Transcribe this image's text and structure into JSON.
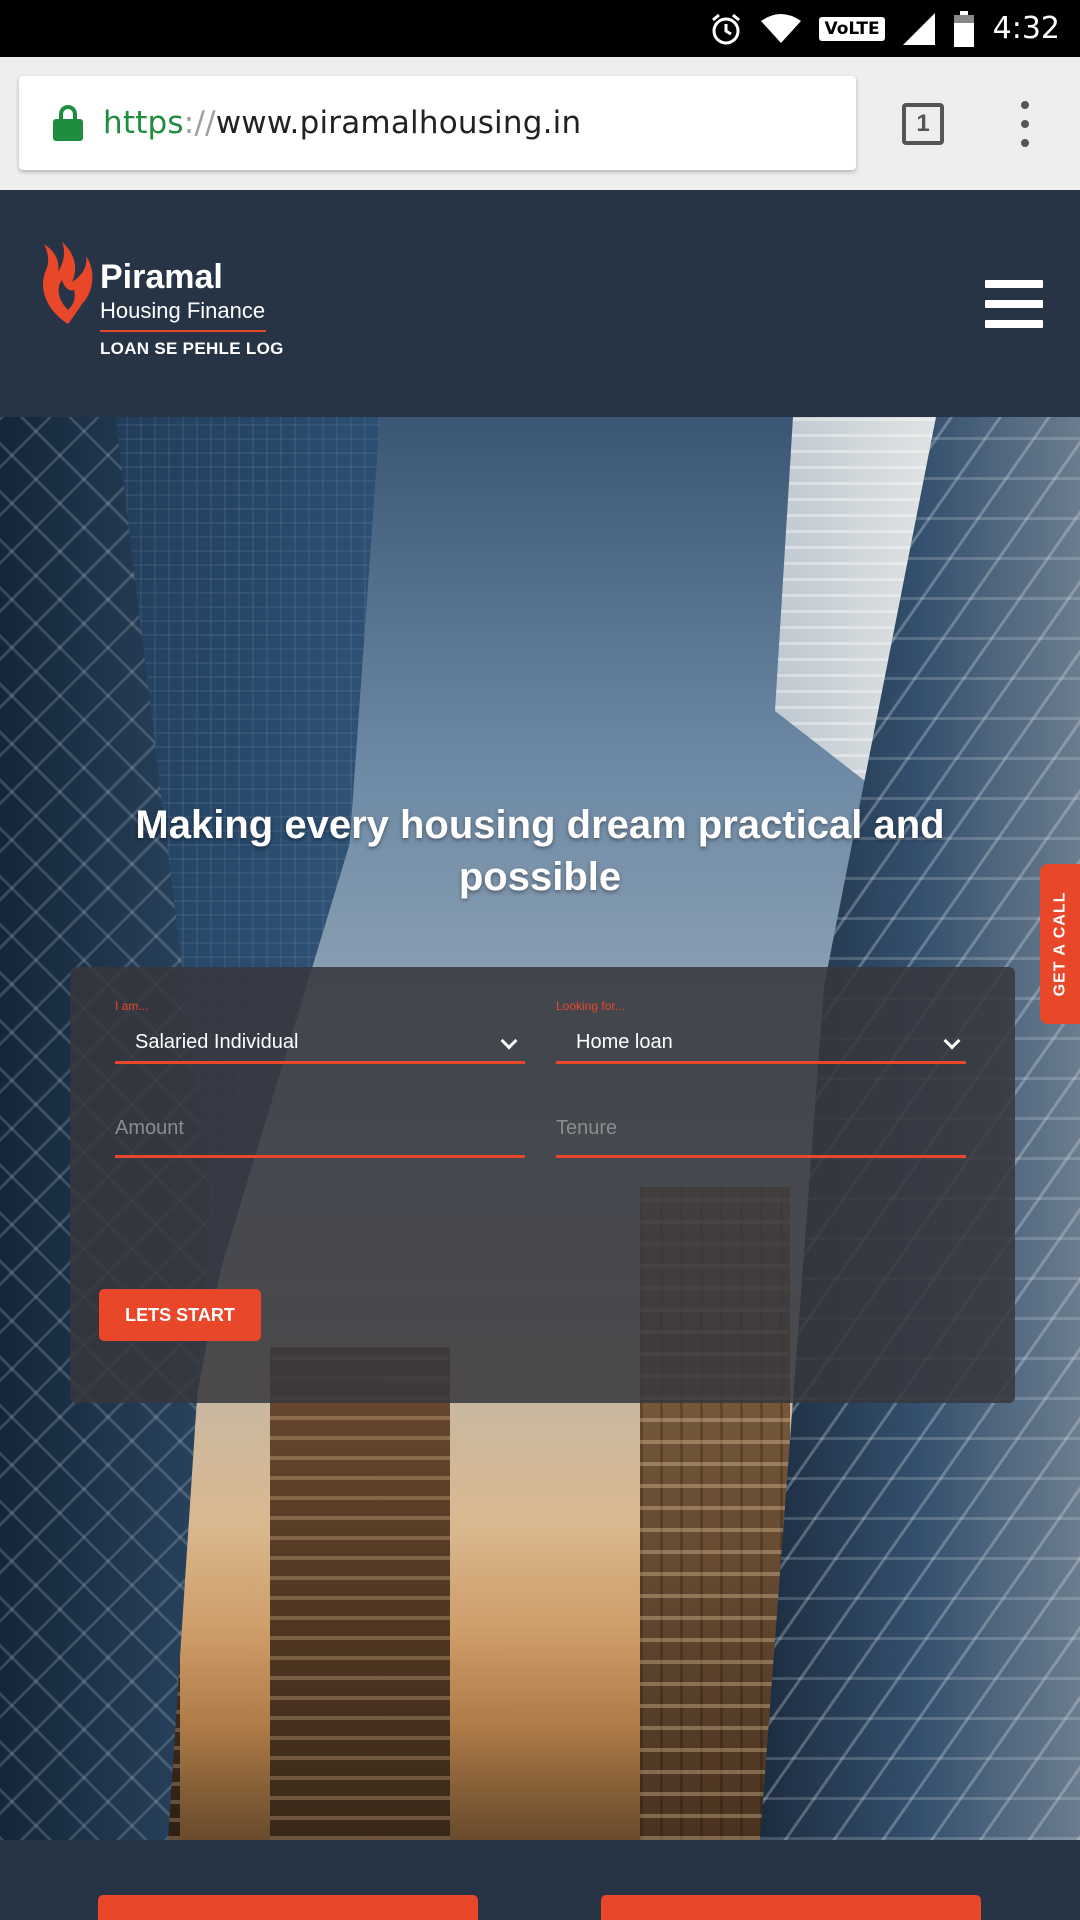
{
  "status_bar": {
    "time": "4:32",
    "volte_label": "VoLTE",
    "icons": [
      "alarm-icon",
      "wifi-icon",
      "signal-icon",
      "battery-icon"
    ]
  },
  "browser": {
    "url_scheme": "https",
    "url_separator": "://",
    "url_host": "www.piramalhousing.in",
    "tab_count": "1"
  },
  "header": {
    "brand_name": "Piramal",
    "brand_sub": "Housing Finance",
    "tagline": "LOAN SE PEHLE LOG"
  },
  "hero": {
    "title": "Making every housing dream practical and possible",
    "side_button": "GET A CALL"
  },
  "form": {
    "iam_label": "I am...",
    "iam_value": "Salaried Individual",
    "looking_label": "Looking for...",
    "looking_value": "Home loan",
    "amount_placeholder": "Amount",
    "tenure_placeholder": "Tenure",
    "submit_label": "LETS START"
  },
  "colors": {
    "accent": "#e8472a",
    "header_bg": "#263445",
    "secure_green": "#1e8e3e"
  }
}
